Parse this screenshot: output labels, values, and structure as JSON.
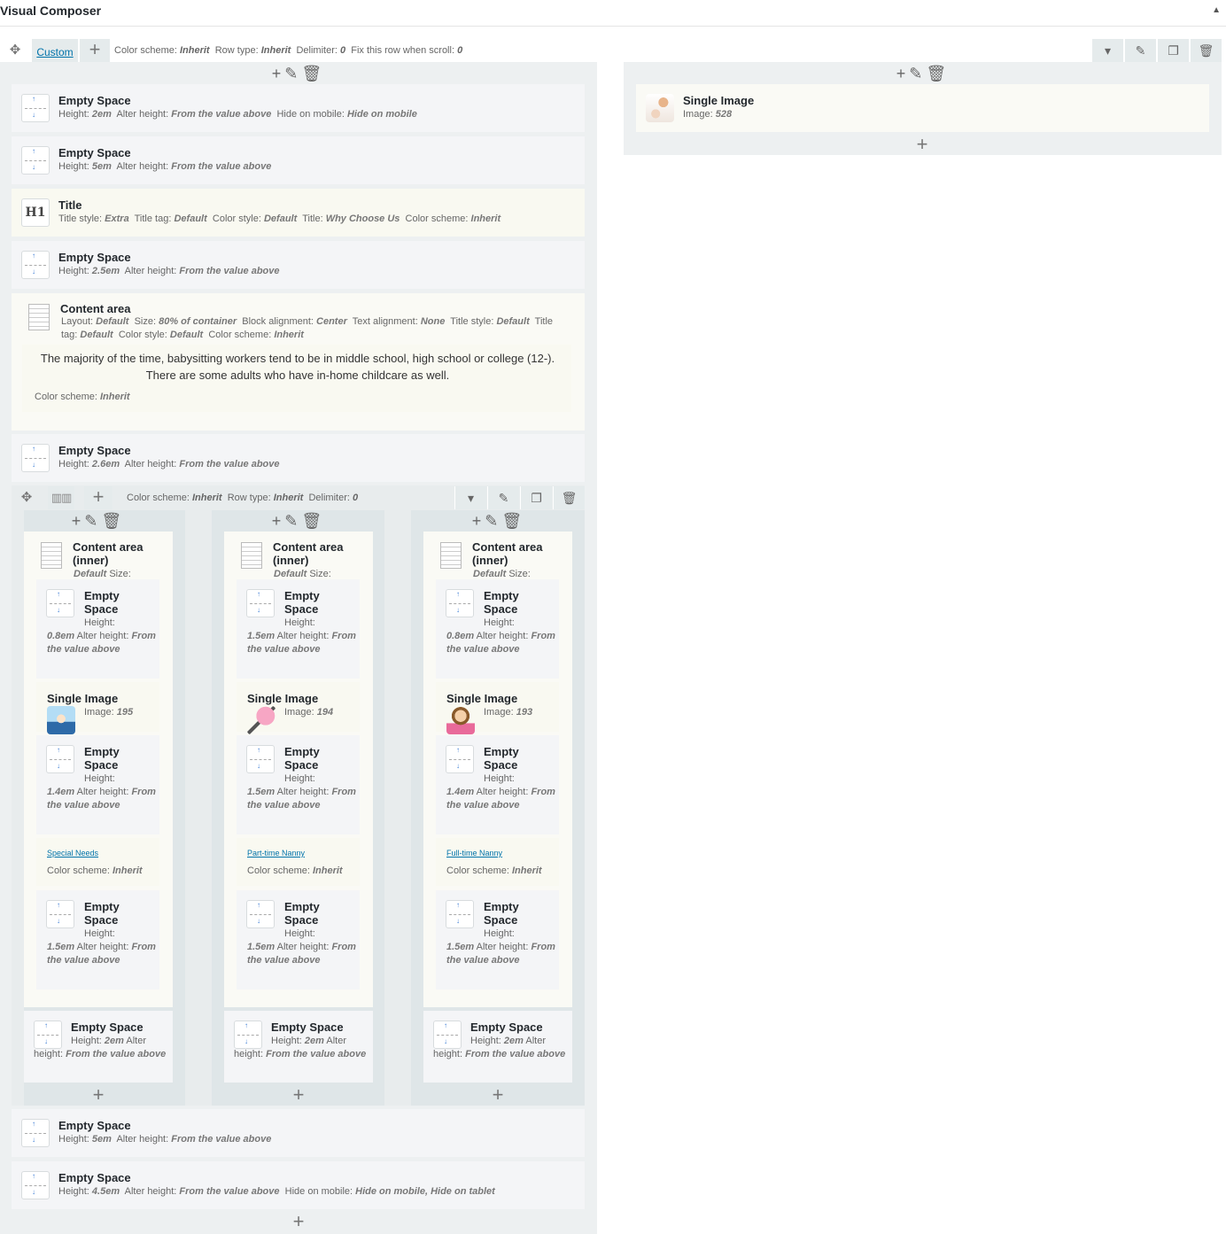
{
  "header": {
    "title": "Visual Composer",
    "toggle": "▲"
  },
  "row": {
    "layout_label": "Custom",
    "params": [
      {
        "k": "Color scheme",
        "v": "Inherit"
      },
      {
        "k": "Row type",
        "v": "Inherit"
      },
      {
        "k": "Delimiter",
        "v": "0"
      },
      {
        "k": "Fix this row when scroll",
        "v": "0"
      }
    ]
  },
  "left_col": {
    "elements": [
      {
        "title": "Empty Space",
        "params": [
          {
            "k": "Height",
            "v": "2em"
          },
          {
            "k": "Alter height",
            "v": "From the value above"
          },
          {
            "k": "Hide on mobile",
            "v": "Hide on mobile"
          }
        ]
      },
      {
        "title": "Empty Space",
        "params": [
          {
            "k": "Height",
            "v": "5em"
          },
          {
            "k": "Alter height",
            "v": "From the value above"
          }
        ]
      },
      {
        "title": "Title",
        "params": [
          {
            "k": "Title style",
            "v": "Extra"
          },
          {
            "k": "Title tag",
            "v": "Default"
          },
          {
            "k": "Color style",
            "v": "Default"
          },
          {
            "k": "Title",
            "v": "Why Choose Us"
          },
          {
            "k": "Color scheme",
            "v": "Inherit"
          }
        ]
      },
      {
        "title": "Empty Space",
        "params": [
          {
            "k": "Height",
            "v": "2.5em"
          },
          {
            "k": "Alter height",
            "v": "From the value above"
          }
        ]
      },
      {
        "title": "Content area",
        "params": [
          {
            "k": "Layout",
            "v": "Default"
          },
          {
            "k": "Size",
            "v": "80% of container"
          },
          {
            "k": "Block alignment",
            "v": "Center"
          },
          {
            "k": "Text alignment",
            "v": "None"
          },
          {
            "k": "Title style",
            "v": "Default"
          },
          {
            "k": "Title tag",
            "v": "Default"
          },
          {
            "k": "Color style",
            "v": "Default"
          },
          {
            "k": "Color scheme",
            "v": "Inherit"
          }
        ],
        "text": "The majority of the time, babysitting workers tend to be in middle school, high school or college (12-). There are some adults who have in-home childcare as well.",
        "inner_params": [
          {
            "k": "Color scheme",
            "v": "Inherit"
          }
        ]
      },
      {
        "title": "Empty Space",
        "params": [
          {
            "k": "Height",
            "v": "2.6em"
          },
          {
            "k": "Alter height",
            "v": "From the value above"
          }
        ]
      }
    ],
    "bottom_elements": [
      {
        "title": "Empty Space",
        "params": [
          {
            "k": "Height",
            "v": "5em"
          },
          {
            "k": "Alter height",
            "v": "From the value above"
          }
        ]
      },
      {
        "title": "Empty Space",
        "params": [
          {
            "k": "Height",
            "v": "4.5em"
          },
          {
            "k": "Alter height",
            "v": "From the value above"
          },
          {
            "k": "Hide on mobile",
            "v": "Hide on mobile, Hide on tablet"
          }
        ]
      }
    ]
  },
  "right_col": {
    "element": {
      "title": "Single Image",
      "params": [
        {
          "k": "Image",
          "v": "528"
        }
      ]
    }
  },
  "inner_row": {
    "params": [
      {
        "k": "Color scheme",
        "v": "Inherit"
      },
      {
        "k": "Row type",
        "v": "Inherit"
      },
      {
        "k": "Delimiter",
        "v": "0"
      }
    ],
    "columns": [
      {
        "content_title": "Content area (inner)",
        "content_params": "Default",
        "size_label": "Size:",
        "es1": {
          "title": "Empty Space",
          "height": "0.8em"
        },
        "image": {
          "title": "Single Image",
          "value": "195"
        },
        "es2": {
          "title": "Empty Space",
          "height": "1.4em"
        },
        "link": "Special Needs",
        "color": {
          "k": "Color scheme",
          "v": "Inherit"
        },
        "es3": {
          "title": "Empty Space",
          "height": "1.5em"
        },
        "bottom": {
          "title": "Empty Space",
          "height": "2em"
        }
      },
      {
        "content_title": "Content area (inner)",
        "content_params": "Default",
        "size_label": "Size:",
        "es1": {
          "title": "Empty Space",
          "height": "1.5em"
        },
        "image": {
          "title": "Single Image",
          "value": "194"
        },
        "es2": {
          "title": "Empty Space",
          "height": "1.5em"
        },
        "link": "Part-time Nanny",
        "color": {
          "k": "Color scheme",
          "v": "Inherit"
        },
        "es3": {
          "title": "Empty Space",
          "height": "1.5em"
        },
        "bottom": {
          "title": "Empty Space",
          "height": "2em"
        }
      },
      {
        "content_title": "Content area (inner)",
        "content_params": "Default",
        "size_label": "Size:",
        "es1": {
          "title": "Empty Space",
          "height": "0.8em"
        },
        "image": {
          "title": "Single Image",
          "value": "193"
        },
        "es2": {
          "title": "Empty Space",
          "height": "1.4em"
        },
        "link": "Full-time Nanny",
        "color": {
          "k": "Color scheme",
          "v": "Inherit"
        },
        "es3": {
          "title": "Empty Space",
          "height": "1.5em"
        },
        "bottom": {
          "title": "Empty Space",
          "height": "2em"
        }
      }
    ]
  },
  "labels": {
    "height": "Height",
    "alter_height": "Alter height",
    "alter_value": "From the value above",
    "image": "Image"
  },
  "icons": {
    "move": "move-icon",
    "plus": "plus-icon",
    "edit": "pencil-icon",
    "delete": "trash-icon",
    "clone": "clone-icon",
    "dropdown": "chevron-down-icon"
  }
}
